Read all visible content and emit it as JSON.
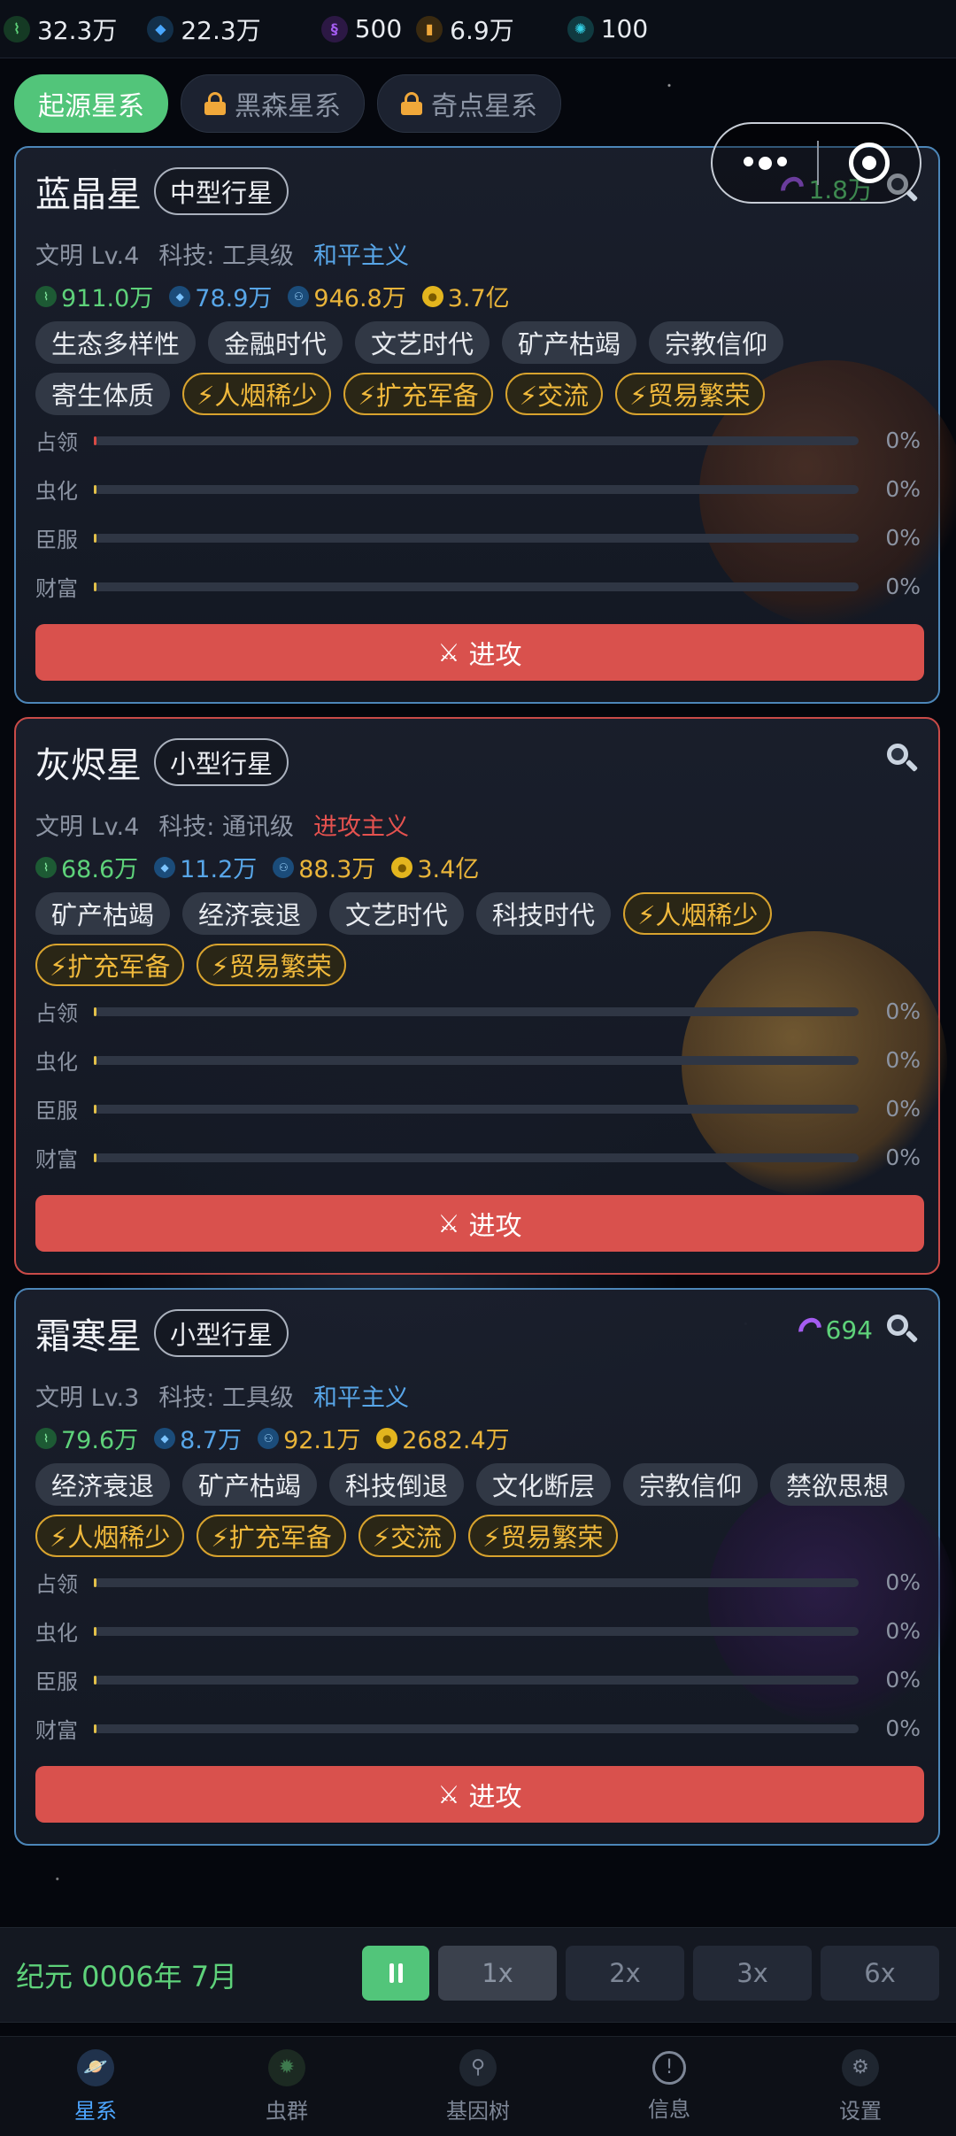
{
  "resources": [
    {
      "icon": "dna-icon",
      "value": "32.3万"
    },
    {
      "icon": "crystal-icon",
      "value": "22.3万"
    },
    {
      "icon": "purple-gene-icon",
      "value": "500"
    },
    {
      "icon": "amber-item-icon",
      "value": "6.9万"
    },
    {
      "icon": "cyan-gear-icon",
      "value": "100"
    }
  ],
  "galaxy_tabs": [
    {
      "label": "起源星系",
      "active": true,
      "locked": false
    },
    {
      "label": "黑森星系",
      "active": false,
      "locked": true
    },
    {
      "label": "奇点星系",
      "active": false,
      "locked": true
    }
  ],
  "bar_labels": [
    "占领",
    "虫化",
    "臣服",
    "财富"
  ],
  "attack_label": "进攻",
  "planets": [
    {
      "name": "蓝晶星",
      "type": "中型行星",
      "worm_value": "1.8万",
      "civ": "文明 Lv.4",
      "tech": "科技: 工具级",
      "ideology": "和平主义",
      "stats": [
        "911.0万",
        "78.9万",
        "946.8万",
        "3.7亿"
      ],
      "tags": [
        "生态多样性",
        "金融时代",
        "文艺时代",
        "矿产枯竭",
        "宗教信仰",
        "寄生体质"
      ],
      "event_tags": [
        "⚡人烟稀少",
        "⚡扩充军备",
        "⚡交流",
        "⚡贸易繁荣"
      ],
      "progress": [
        "0%",
        "0%",
        "0%",
        "0%"
      ]
    },
    {
      "name": "灰烬星",
      "type": "小型行星",
      "worm_value": "",
      "civ": "文明 Lv.4",
      "tech": "科技: 通讯级",
      "ideology": "进攻主义",
      "stats": [
        "68.6万",
        "11.2万",
        "88.3万",
        "3.4亿"
      ],
      "tags": [
        "矿产枯竭",
        "经济衰退",
        "文艺时代",
        "科技时代"
      ],
      "event_tags": [
        "⚡人烟稀少",
        "⚡扩充军备",
        "⚡贸易繁荣"
      ],
      "progress": [
        "0%",
        "0%",
        "0%",
        "0%"
      ]
    },
    {
      "name": "霜寒星",
      "type": "小型行星",
      "worm_value": "694",
      "civ": "文明 Lv.3",
      "tech": "科技: 工具级",
      "ideology": "和平主义",
      "stats": [
        "79.6万",
        "8.7万",
        "92.1万",
        "2682.4万"
      ],
      "tags": [
        "经济衰退",
        "矿产枯竭",
        "科技倒退",
        "文化断层",
        "宗教信仰",
        "禁欲思想"
      ],
      "event_tags": [
        "⚡人烟稀少",
        "⚡扩充军备",
        "⚡交流",
        "⚡贸易繁荣"
      ],
      "progress": [
        "0%",
        "0%",
        "0%",
        "0%"
      ]
    }
  ],
  "timebar": {
    "era": "纪元 0006年 7月",
    "speeds": [
      "1x",
      "2x",
      "3x",
      "6x"
    ],
    "selected_speed": "1x",
    "paused": true
  },
  "nav": [
    {
      "label": "星系",
      "icon": "planet-icon",
      "active": true
    },
    {
      "label": "虫群",
      "icon": "swarm-icon",
      "active": false
    },
    {
      "label": "基因树",
      "icon": "gene-tree-icon",
      "active": false
    },
    {
      "label": "信息",
      "icon": "info-icon",
      "active": false
    },
    {
      "label": "设置",
      "icon": "gear-icon",
      "active": false
    }
  ],
  "colors": {
    "accent_green": "#52c57a",
    "attack_red": "#d9514d",
    "peace_blue": "#58a6e8",
    "war_red": "#e5524f",
    "event_gold": "#f0b93c"
  }
}
